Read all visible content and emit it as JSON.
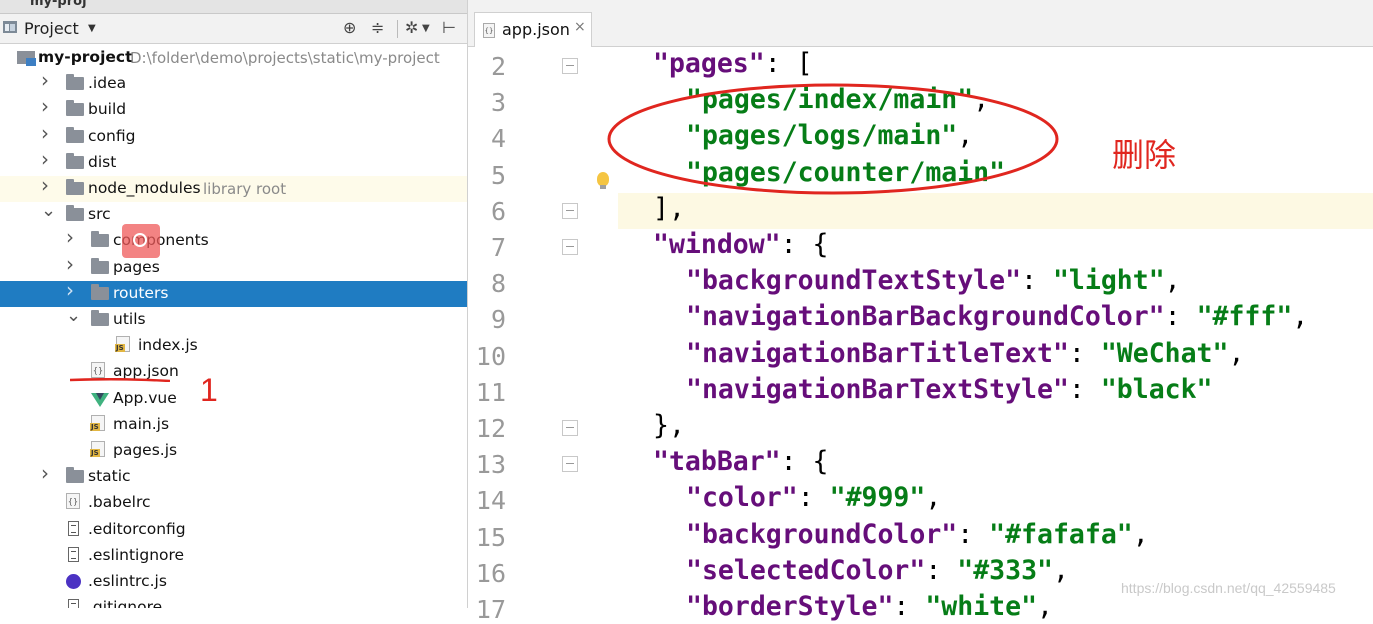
{
  "window_title_fragment": "my-proj",
  "project_panel": {
    "title": "Project",
    "buttons": [
      "locate-icon",
      "collapse-icon",
      "gear-icon",
      "hide-icon"
    ],
    "tree": [
      {
        "label": "my-project",
        "path": "D:\\folder\\demo\\projects\\static\\my-project",
        "depth": 0,
        "type": "project-folder",
        "expanded": true
      },
      {
        "label": ".idea",
        "depth": 1,
        "type": "folder",
        "expanded": false
      },
      {
        "label": "build",
        "depth": 1,
        "type": "folder",
        "expanded": false
      },
      {
        "label": "config",
        "depth": 1,
        "type": "folder",
        "expanded": false
      },
      {
        "label": "dist",
        "depth": 1,
        "type": "folder",
        "expanded": false
      },
      {
        "label": "node_modules",
        "extra": "library root",
        "depth": 1,
        "type": "folder",
        "expanded": false
      },
      {
        "label": "src",
        "depth": 1,
        "type": "folder",
        "expanded": true
      },
      {
        "label": "components",
        "depth": 2,
        "type": "folder",
        "expanded": false
      },
      {
        "label": "pages",
        "depth": 2,
        "type": "folder",
        "expanded": false
      },
      {
        "label": "routers",
        "depth": 2,
        "type": "folder",
        "expanded": false,
        "selected": true
      },
      {
        "label": "utils",
        "depth": 2,
        "type": "folder",
        "expanded": true
      },
      {
        "label": "index.js",
        "depth": 3,
        "type": "js"
      },
      {
        "label": "app.json",
        "depth": 2,
        "type": "json"
      },
      {
        "label": "App.vue",
        "depth": 2,
        "type": "vue"
      },
      {
        "label": "main.js",
        "depth": 2,
        "type": "js"
      },
      {
        "label": "pages.js",
        "depth": 2,
        "type": "js"
      },
      {
        "label": "static",
        "depth": 1,
        "type": "folder",
        "expanded": false
      },
      {
        "label": ".babelrc",
        "depth": 1,
        "type": "json"
      },
      {
        "label": ".editorconfig",
        "depth": 1,
        "type": "text"
      },
      {
        "label": ".eslintignore",
        "depth": 1,
        "type": "text"
      },
      {
        "label": ".eslintrc.js",
        "depth": 1,
        "type": "eslint"
      },
      {
        "label": ".gitignore",
        "depth": 1,
        "type": "text"
      }
    ]
  },
  "editor": {
    "tab": {
      "label": "app.json",
      "close": "×"
    },
    "lines": [
      {
        "n": "2",
        "indent": 2,
        "parts": [
          [
            "k",
            "\"pages\""
          ],
          [
            "p",
            ": ["
          ]
        ]
      },
      {
        "n": "3",
        "indent": 4,
        "parts": [
          [
            "s",
            "\"pages/index/main\""
          ],
          [
            "p",
            ","
          ]
        ]
      },
      {
        "n": "4",
        "indent": 4,
        "parts": [
          [
            "s",
            "\"pages/logs/main\""
          ],
          [
            "p",
            ","
          ]
        ]
      },
      {
        "n": "5",
        "indent": 4,
        "parts": [
          [
            "s",
            "\"pages/counter/main\""
          ]
        ]
      },
      {
        "n": "6",
        "indent": 2,
        "parts": [
          [
            "p",
            "],"
          ]
        ]
      },
      {
        "n": "7",
        "indent": 2,
        "parts": [
          [
            "k",
            "\"window\""
          ],
          [
            "p",
            ": {"
          ]
        ]
      },
      {
        "n": "8",
        "indent": 4,
        "parts": [
          [
            "k",
            "\"backgroundTextStyle\""
          ],
          [
            "p",
            ": "
          ],
          [
            "s",
            "\"light\""
          ],
          [
            "p",
            ","
          ]
        ]
      },
      {
        "n": "9",
        "indent": 4,
        "parts": [
          [
            "k",
            "\"navigationBarBackgroundColor\""
          ],
          [
            "p",
            ": "
          ],
          [
            "s",
            "\"#fff\""
          ],
          [
            "p",
            ","
          ]
        ]
      },
      {
        "n": "10",
        "indent": 4,
        "parts": [
          [
            "k",
            "\"navigationBarTitleText\""
          ],
          [
            "p",
            ": "
          ],
          [
            "s",
            "\"WeChat\""
          ],
          [
            "p",
            ","
          ]
        ]
      },
      {
        "n": "11",
        "indent": 4,
        "parts": [
          [
            "k",
            "\"navigationBarTextStyle\""
          ],
          [
            "p",
            ": "
          ],
          [
            "s",
            "\"black\""
          ]
        ]
      },
      {
        "n": "12",
        "indent": 2,
        "parts": [
          [
            "p",
            "},"
          ]
        ]
      },
      {
        "n": "13",
        "indent": 2,
        "parts": [
          [
            "k",
            "\"tabBar\""
          ],
          [
            "p",
            ": {"
          ]
        ]
      },
      {
        "n": "14",
        "indent": 4,
        "parts": [
          [
            "k",
            "\"color\""
          ],
          [
            "p",
            ": "
          ],
          [
            "s",
            "\"#999\""
          ],
          [
            "p",
            ","
          ]
        ]
      },
      {
        "n": "15",
        "indent": 4,
        "parts": [
          [
            "k",
            "\"backgroundColor\""
          ],
          [
            "p",
            ": "
          ],
          [
            "s",
            "\"#fafafa\""
          ],
          [
            "p",
            ","
          ]
        ]
      },
      {
        "n": "16",
        "indent": 4,
        "parts": [
          [
            "k",
            "\"selectedColor\""
          ],
          [
            "p",
            ": "
          ],
          [
            "s",
            "\"#333\""
          ],
          [
            "p",
            ","
          ]
        ]
      },
      {
        "n": "17",
        "indent": 4,
        "parts": [
          [
            "k",
            "\"borderStyle\""
          ],
          [
            "p",
            ": "
          ],
          [
            "s",
            "\"white\""
          ],
          [
            "p",
            ","
          ]
        ]
      }
    ]
  },
  "annotations": {
    "delete_label": "删除",
    "step_number": "1",
    "watermark": "https://blog.csdn.net/qq_42559485"
  },
  "colors": {
    "selection": "#1f7cc2",
    "json_key": "#660e7a",
    "json_string": "#067d17",
    "annotation_red": "#e0261f",
    "library_row_bg": "#fefbea",
    "current_line_bg": "#fdf9e3"
  }
}
